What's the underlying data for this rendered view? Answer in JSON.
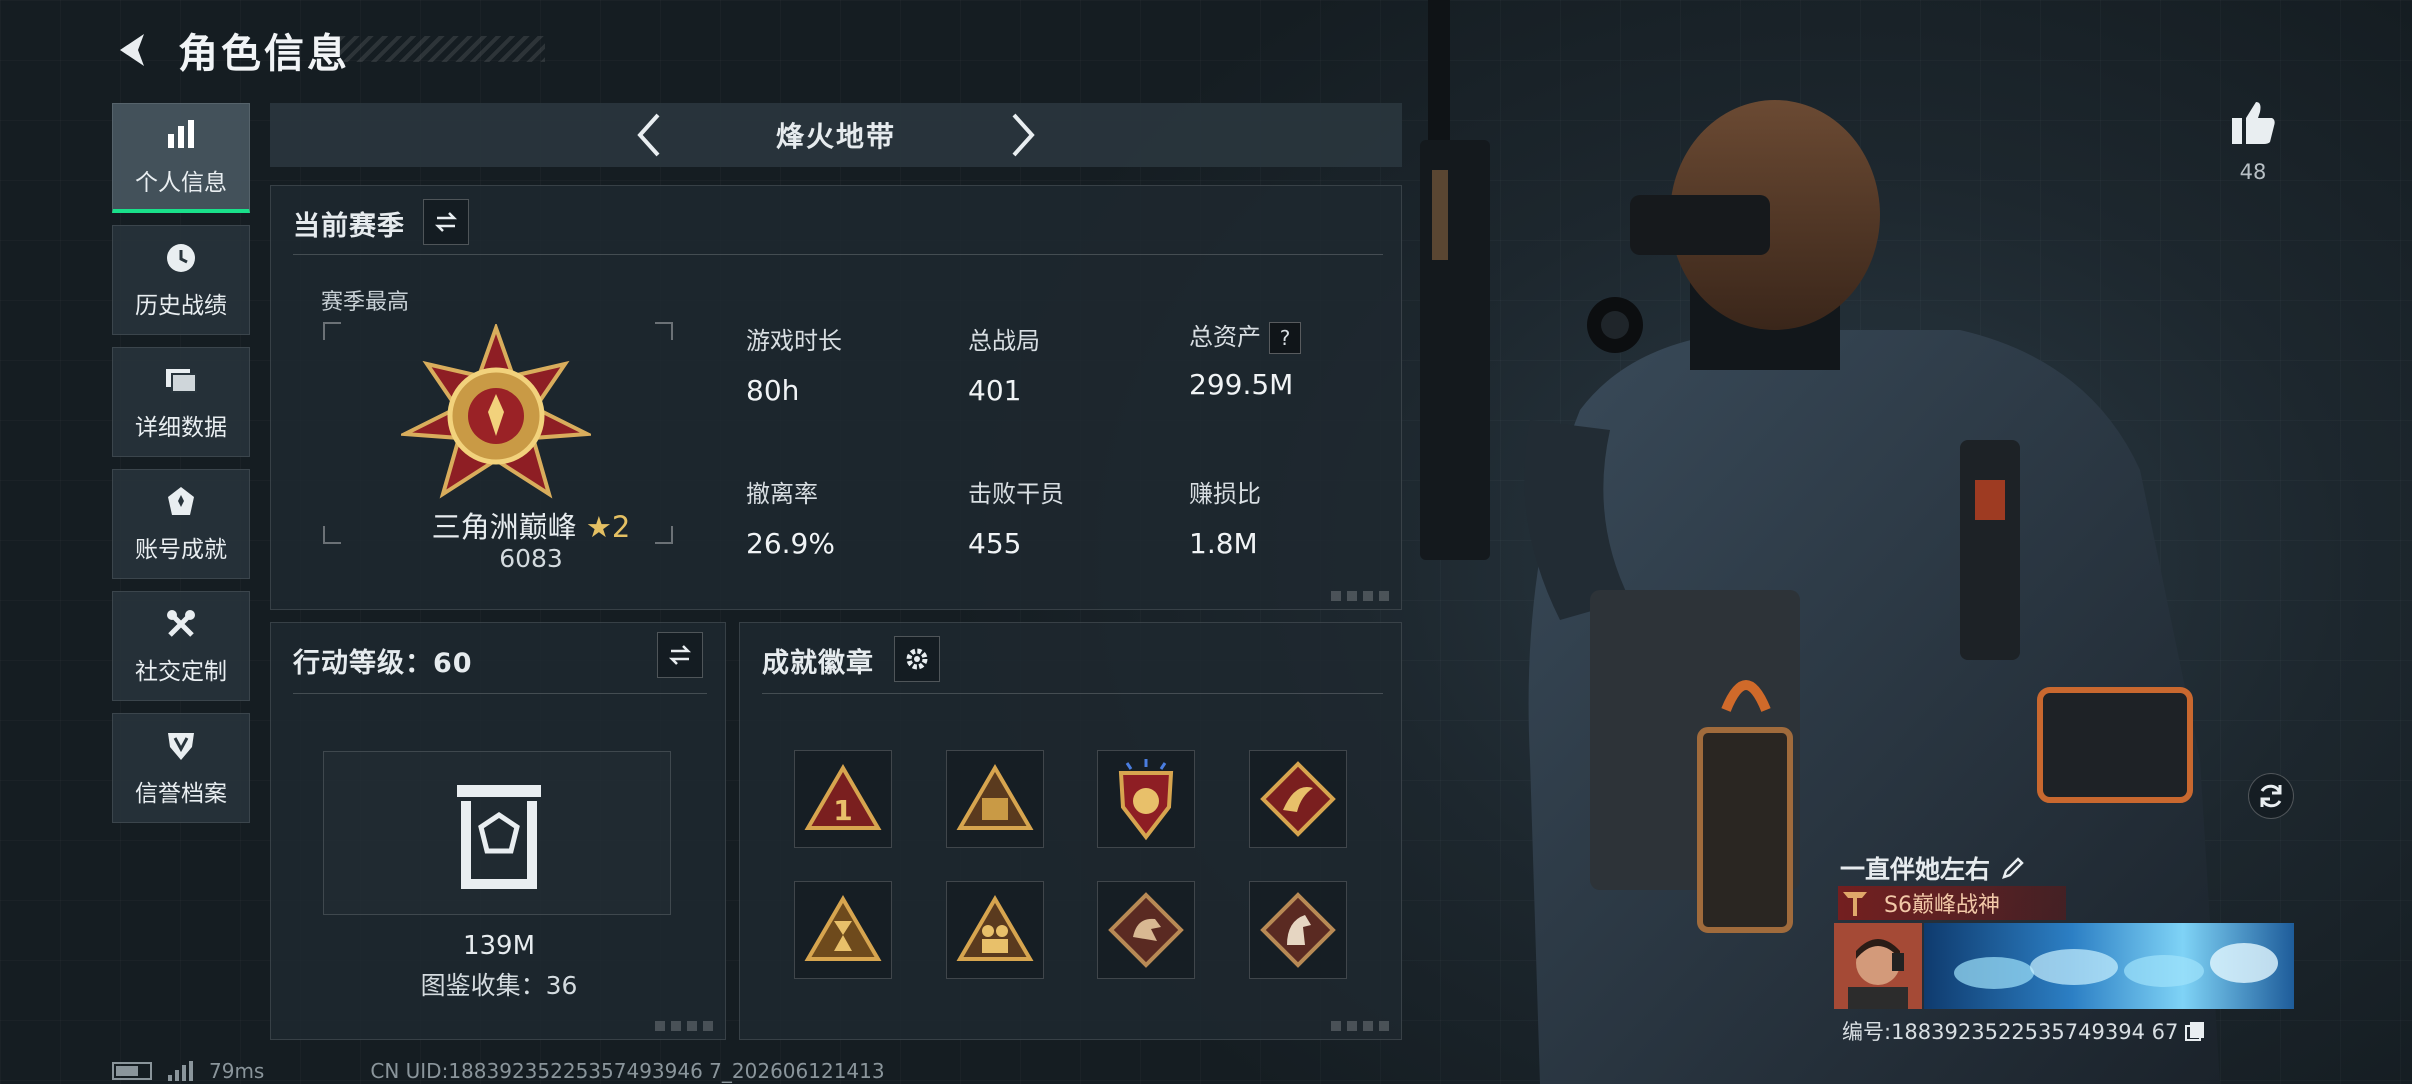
{
  "header": {
    "title": "角色信息"
  },
  "sidebar": {
    "items": [
      {
        "label": "个人信息",
        "icon": "bar-chart-icon",
        "active": true
      },
      {
        "label": "历史战绩",
        "icon": "history-clock-icon",
        "active": false
      },
      {
        "label": "详细数据",
        "icon": "folder-icon",
        "active": false
      },
      {
        "label": "账号成就",
        "icon": "achievement-icon",
        "active": false
      },
      {
        "label": "社交定制",
        "icon": "tools-icon",
        "active": false
      },
      {
        "label": "信誉档案",
        "icon": "shield-badge-icon",
        "active": false
      }
    ]
  },
  "map": {
    "name": "烽火地带"
  },
  "season": {
    "title": "当前赛季",
    "best_label": "赛季最高",
    "rank_name": "三角洲巅峰",
    "rank_star": "★2",
    "rank_score": "6083",
    "stats": [
      {
        "label": "游戏时长",
        "value": "80h"
      },
      {
        "label": "总战局",
        "value": "401"
      },
      {
        "label": "总资产",
        "value": "299.5M",
        "help": "?"
      },
      {
        "label": "撤离率",
        "value": "26.9%"
      },
      {
        "label": "击败干员",
        "value": "455"
      },
      {
        "label": "赚损比",
        "value": "1.8M"
      }
    ]
  },
  "action_level": {
    "title": "行动等级：60",
    "collection_value": "139M",
    "collection_count": "图鉴收集：36"
  },
  "badges": {
    "title": "成就徽章",
    "items": [
      "badge-rank-1",
      "badge-s8",
      "badge-star-shield",
      "badge-bird",
      "badge-hourglass",
      "badge-soldiers",
      "badge-dragon",
      "badge-horse"
    ]
  },
  "profile": {
    "likes": "48",
    "player_name": "一直伴她左右",
    "title": "S6巅峰战神",
    "uid": "编号:1883923522535749394 67"
  },
  "status": {
    "ping": "79ms",
    "cn_uid": "CN UID:18839235225357493946 7_202606121413"
  },
  "colors": {
    "accent_green": "#19e08a",
    "gold": "#e4c063",
    "title_red": "#781e1e"
  }
}
